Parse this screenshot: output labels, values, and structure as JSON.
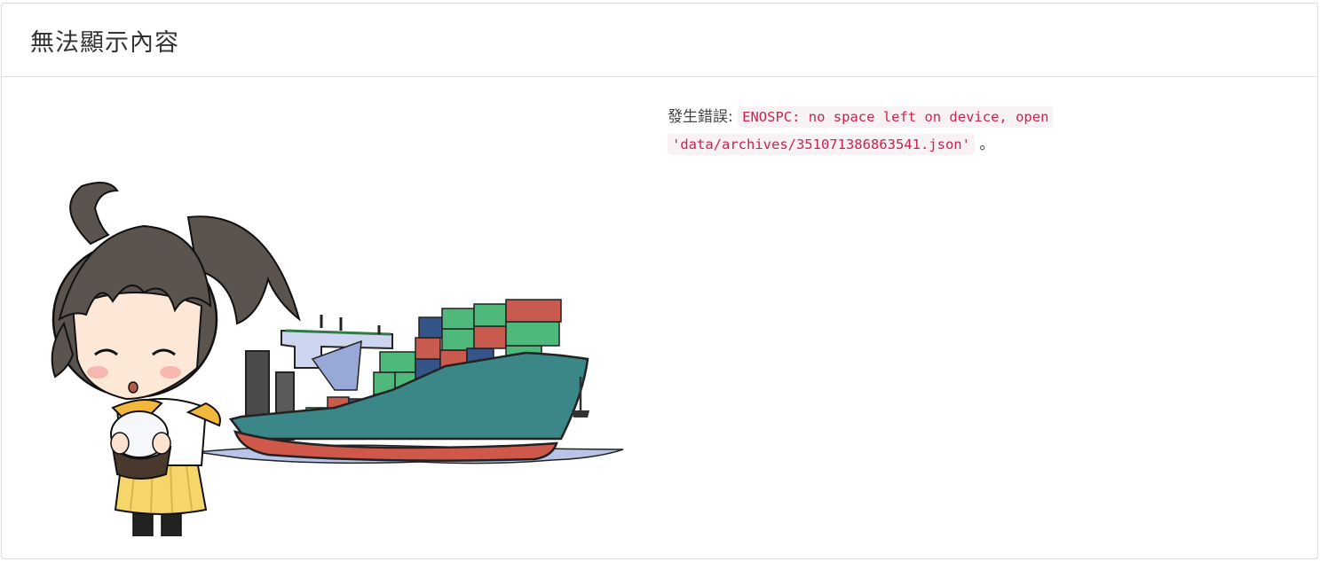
{
  "header": {
    "title": "無法顯示內容"
  },
  "error": {
    "prefix": "發生錯誤:",
    "code": "ENOSPC: no space left on device, open 'data/archives/351071386863541.json'",
    "suffix": "。"
  },
  "illustration": {
    "characters": [
      "chibi-girl-holding-plate",
      "container-cargo-ship"
    ],
    "colors": {
      "hair": "#5a534e",
      "skirt": "#f6d56a",
      "ship_hull": "#3b8686",
      "ship_bottom": "#d0584a",
      "container_red": "#c95a4e",
      "container_green": "#4fb87b",
      "container_blue": "#34548a",
      "water": "#b8c4e8"
    }
  }
}
